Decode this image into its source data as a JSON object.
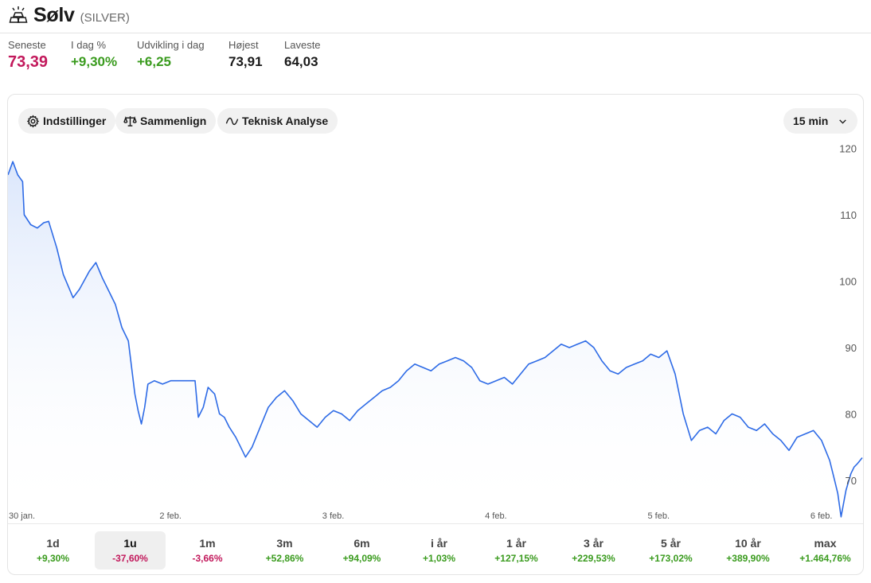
{
  "header": {
    "title": "Sølv",
    "ticker": "(SILVER)",
    "icon": "silver-bars-icon"
  },
  "stats": [
    {
      "label": "Seneste",
      "value": "73,39",
      "color": "#c2185b",
      "big": true
    },
    {
      "label": "I dag %",
      "value": "+9,30%",
      "color": "#3a9b1e"
    },
    {
      "label": "Udvikling i dag",
      "value": "+6,25",
      "color": "#3a9b1e"
    },
    {
      "label": "Højest",
      "value": "73,91",
      "color": "#1a1a1a"
    },
    {
      "label": "Laveste",
      "value": "64,03",
      "color": "#1a1a1a"
    }
  ],
  "toolbar": {
    "settings_label": "Indstillinger",
    "compare_label": "Sammenlign",
    "ta_label": "Teknisk Analyse",
    "interval_label": "15 min"
  },
  "chart_data": {
    "type": "area",
    "line_color": "#2e6be6",
    "fill_color": "#e6eefc",
    "y_ticks": [
      70,
      80,
      90,
      100,
      110,
      120
    ],
    "ylim": [
      64,
      120
    ],
    "x_ticks": [
      {
        "label": "30 jan.",
        "x": 0
      },
      {
        "label": "2 feb.",
        "x": 1
      },
      {
        "label": "3 feb.",
        "x": 2
      },
      {
        "label": "4 feb.",
        "x": 3
      },
      {
        "label": "5 feb.",
        "x": 4
      },
      {
        "label": "6 feb.",
        "x": 5
      }
    ],
    "xlim": [
      0,
      5.25
    ],
    "series": [
      {
        "values": [
          [
            0.0,
            116.0
          ],
          [
            0.03,
            118.0
          ],
          [
            0.06,
            116.0
          ],
          [
            0.09,
            115.0
          ],
          [
            0.1,
            110.0
          ],
          [
            0.14,
            108.5
          ],
          [
            0.18,
            108.0
          ],
          [
            0.22,
            108.8
          ],
          [
            0.25,
            109.0
          ],
          [
            0.3,
            105.0
          ],
          [
            0.34,
            101.0
          ],
          [
            0.4,
            97.5
          ],
          [
            0.44,
            98.8
          ],
          [
            0.5,
            101.5
          ],
          [
            0.54,
            102.8
          ],
          [
            0.58,
            100.5
          ],
          [
            0.62,
            98.5
          ],
          [
            0.66,
            96.5
          ],
          [
            0.7,
            93.0
          ],
          [
            0.74,
            91.0
          ],
          [
            0.76,
            87.0
          ],
          [
            0.78,
            83.0
          ],
          [
            0.8,
            80.5
          ],
          [
            0.82,
            78.5
          ],
          [
            0.84,
            81.0
          ],
          [
            0.86,
            84.5
          ],
          [
            0.9,
            85.0
          ],
          [
            0.95,
            84.5
          ],
          [
            1.0,
            85.0
          ],
          [
            1.05,
            85.0
          ],
          [
            1.1,
            85.0
          ],
          [
            1.15,
            85.0
          ],
          [
            1.17,
            79.5
          ],
          [
            1.2,
            81.0
          ],
          [
            1.23,
            84.0
          ],
          [
            1.27,
            83.0
          ],
          [
            1.3,
            80.0
          ],
          [
            1.33,
            79.5
          ],
          [
            1.36,
            78.0
          ],
          [
            1.4,
            76.5
          ],
          [
            1.43,
            75.0
          ],
          [
            1.46,
            73.5
          ],
          [
            1.5,
            75.0
          ],
          [
            1.55,
            78.0
          ],
          [
            1.6,
            81.0
          ],
          [
            1.65,
            82.5
          ],
          [
            1.7,
            83.5
          ],
          [
            1.75,
            82.0
          ],
          [
            1.8,
            80.0
          ],
          [
            1.85,
            79.0
          ],
          [
            1.9,
            78.0
          ],
          [
            1.95,
            79.5
          ],
          [
            2.0,
            80.5
          ],
          [
            2.05,
            80.0
          ],
          [
            2.1,
            79.0
          ],
          [
            2.15,
            80.5
          ],
          [
            2.2,
            81.5
          ],
          [
            2.25,
            82.5
          ],
          [
            2.3,
            83.5
          ],
          [
            2.35,
            84.0
          ],
          [
            2.4,
            85.0
          ],
          [
            2.45,
            86.5
          ],
          [
            2.5,
            87.5
          ],
          [
            2.55,
            87.0
          ],
          [
            2.6,
            86.5
          ],
          [
            2.65,
            87.5
          ],
          [
            2.7,
            88.0
          ],
          [
            2.75,
            88.5
          ],
          [
            2.8,
            88.0
          ],
          [
            2.85,
            87.0
          ],
          [
            2.9,
            85.0
          ],
          [
            2.95,
            84.5
          ],
          [
            3.0,
            85.0
          ],
          [
            3.05,
            85.5
          ],
          [
            3.1,
            84.5
          ],
          [
            3.15,
            86.0
          ],
          [
            3.2,
            87.5
          ],
          [
            3.25,
            88.0
          ],
          [
            3.3,
            88.5
          ],
          [
            3.35,
            89.5
          ],
          [
            3.4,
            90.5
          ],
          [
            3.45,
            90.0
          ],
          [
            3.5,
            90.5
          ],
          [
            3.55,
            91.0
          ],
          [
            3.6,
            90.0
          ],
          [
            3.65,
            88.0
          ],
          [
            3.7,
            86.5
          ],
          [
            3.75,
            86.0
          ],
          [
            3.8,
            87.0
          ],
          [
            3.85,
            87.5
          ],
          [
            3.9,
            88.0
          ],
          [
            3.95,
            89.0
          ],
          [
            4.0,
            88.5
          ],
          [
            4.05,
            89.5
          ],
          [
            4.1,
            86.0
          ],
          [
            4.15,
            80.0
          ],
          [
            4.2,
            76.0
          ],
          [
            4.25,
            77.5
          ],
          [
            4.3,
            78.0
          ],
          [
            4.35,
            77.0
          ],
          [
            4.4,
            79.0
          ],
          [
            4.45,
            80.0
          ],
          [
            4.5,
            79.5
          ],
          [
            4.55,
            78.0
          ],
          [
            4.6,
            77.5
          ],
          [
            4.65,
            78.5
          ],
          [
            4.7,
            77.0
          ],
          [
            4.75,
            76.0
          ],
          [
            4.8,
            74.5
          ],
          [
            4.85,
            76.5
          ],
          [
            4.9,
            77.0
          ],
          [
            4.95,
            77.5
          ],
          [
            5.0,
            76.0
          ],
          [
            5.05,
            73.0
          ],
          [
            5.08,
            70.0
          ],
          [
            5.1,
            68.0
          ],
          [
            5.12,
            64.5
          ],
          [
            5.15,
            68.5
          ],
          [
            5.18,
            71.0
          ],
          [
            5.2,
            72.0
          ],
          [
            5.22,
            72.5
          ],
          [
            5.25,
            73.4
          ]
        ]
      }
    ]
  },
  "periods": [
    {
      "label": "1d",
      "value": "+9,30%",
      "color": "#3a9b1e",
      "active": false
    },
    {
      "label": "1u",
      "value": "-37,60%",
      "color": "#c2185b",
      "active": true
    },
    {
      "label": "1m",
      "value": "-3,66%",
      "color": "#c2185b",
      "active": false
    },
    {
      "label": "3m",
      "value": "+52,86%",
      "color": "#3a9b1e",
      "active": false
    },
    {
      "label": "6m",
      "value": "+94,09%",
      "color": "#3a9b1e",
      "active": false
    },
    {
      "label": "i år",
      "value": "+1,03%",
      "color": "#3a9b1e",
      "active": false
    },
    {
      "label": "1 år",
      "value": "+127,15%",
      "color": "#3a9b1e",
      "active": false
    },
    {
      "label": "3 år",
      "value": "+229,53%",
      "color": "#3a9b1e",
      "active": false
    },
    {
      "label": "5 år",
      "value": "+173,02%",
      "color": "#3a9b1e",
      "active": false
    },
    {
      "label": "10 år",
      "value": "+389,90%",
      "color": "#3a9b1e",
      "active": false
    },
    {
      "label": "max",
      "value": "+1.464,76%",
      "color": "#3a9b1e",
      "active": false
    }
  ]
}
